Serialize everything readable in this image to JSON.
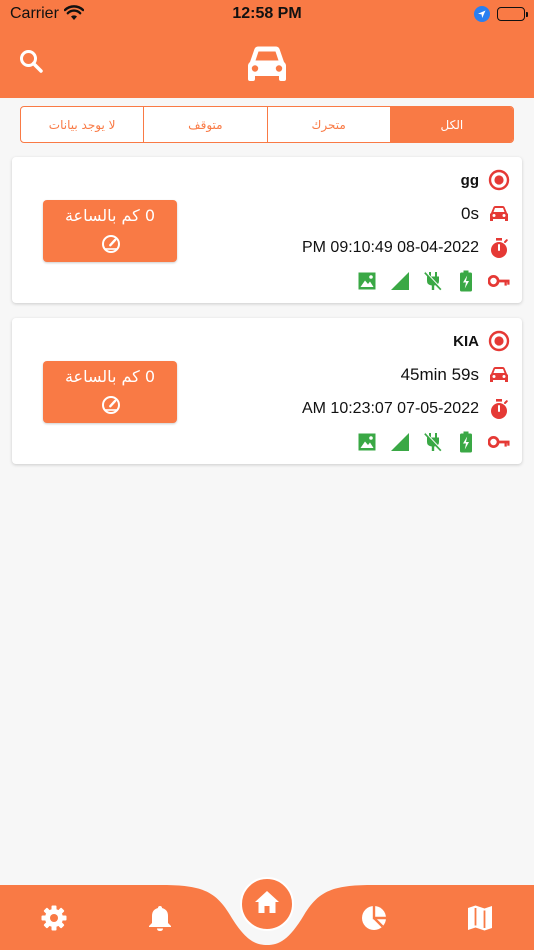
{
  "status_bar": {
    "carrier": "Carrier",
    "time": "12:58 PM"
  },
  "header": {
    "search_icon": "search-icon",
    "logo_icon": "car-icon"
  },
  "filters": {
    "all": "الكل",
    "moving": "متحرك",
    "stopped": "متوقف",
    "no_data": "لا يوجد بيانات",
    "selected": "all"
  },
  "vehicles": [
    {
      "name": "gg",
      "duration": "0s",
      "timestamp": "PM 09:10:49 08-04-2022",
      "speed": "0 كم بالساعة"
    },
    {
      "name": "KIA",
      "duration": "45min 59s",
      "timestamp": "AM 10:23:07 07-05-2022",
      "speed": "0 كم بالساعة"
    }
  ],
  "colors": {
    "accent": "#f97a45",
    "status_red": "#e53935",
    "indicator_green": "#3aa845"
  },
  "nav": [
    "gear-icon",
    "bell-icon",
    "home-icon",
    "pie-chart-icon",
    "map-icon"
  ]
}
